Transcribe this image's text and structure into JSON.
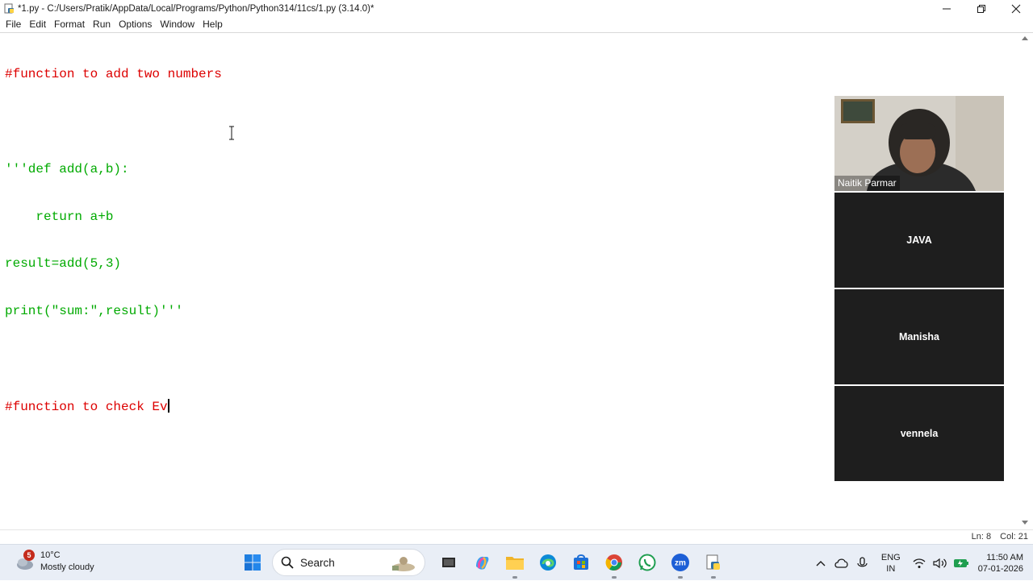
{
  "window": {
    "title": "*1.py - C:/Users/Pratik/AppData/Local/Programs/Python/Python314/11cs/1.py (3.14.0)*",
    "minimize_icon": "minimize-icon",
    "maximize_icon": "restore-icon",
    "close_icon": "close-icon"
  },
  "menu": [
    "File",
    "Edit",
    "Format",
    "Run",
    "Options",
    "Window",
    "Help"
  ],
  "editor": {
    "lines": [
      {
        "type": "comment",
        "text": "#function to add two numbers"
      },
      {
        "type": "blank",
        "text": ""
      },
      {
        "type": "string",
        "text": "'''def add(a,b):"
      },
      {
        "type": "string",
        "text": "    return a+b"
      },
      {
        "type": "string",
        "text": "result=add(5,3)"
      },
      {
        "type": "string",
        "text": "print(\"sum:\",result)'''"
      },
      {
        "type": "blank",
        "text": ""
      },
      {
        "type": "comment",
        "text": "#function to check Ev"
      }
    ],
    "colors": {
      "comment": "#dd0000",
      "string": "#00aa00"
    }
  },
  "status": {
    "line": "Ln: 8",
    "col": "Col: 21"
  },
  "meeting": {
    "participants": [
      {
        "name": "Naitik Parmar",
        "video": true
      },
      {
        "name": "JAVA",
        "video": false
      },
      {
        "name": "Manisha",
        "video": false
      },
      {
        "name": "vennela",
        "video": false
      }
    ]
  },
  "taskbar": {
    "weather_badge": "5",
    "temperature": "10°C",
    "condition": "Mostly cloudy",
    "search_label": "Search",
    "apps": [
      "windows-start-icon",
      "task-view-icon",
      "copilot-icon",
      "file-explorer-icon",
      "edge-icon",
      "store-icon",
      "chrome-icon",
      "whatsapp-icon",
      "zoom-icon",
      "python-idle-icon"
    ],
    "lang_top": "ENG",
    "lang_bottom": "IN",
    "time": "11:50 AM",
    "date": "07-01-2026"
  }
}
